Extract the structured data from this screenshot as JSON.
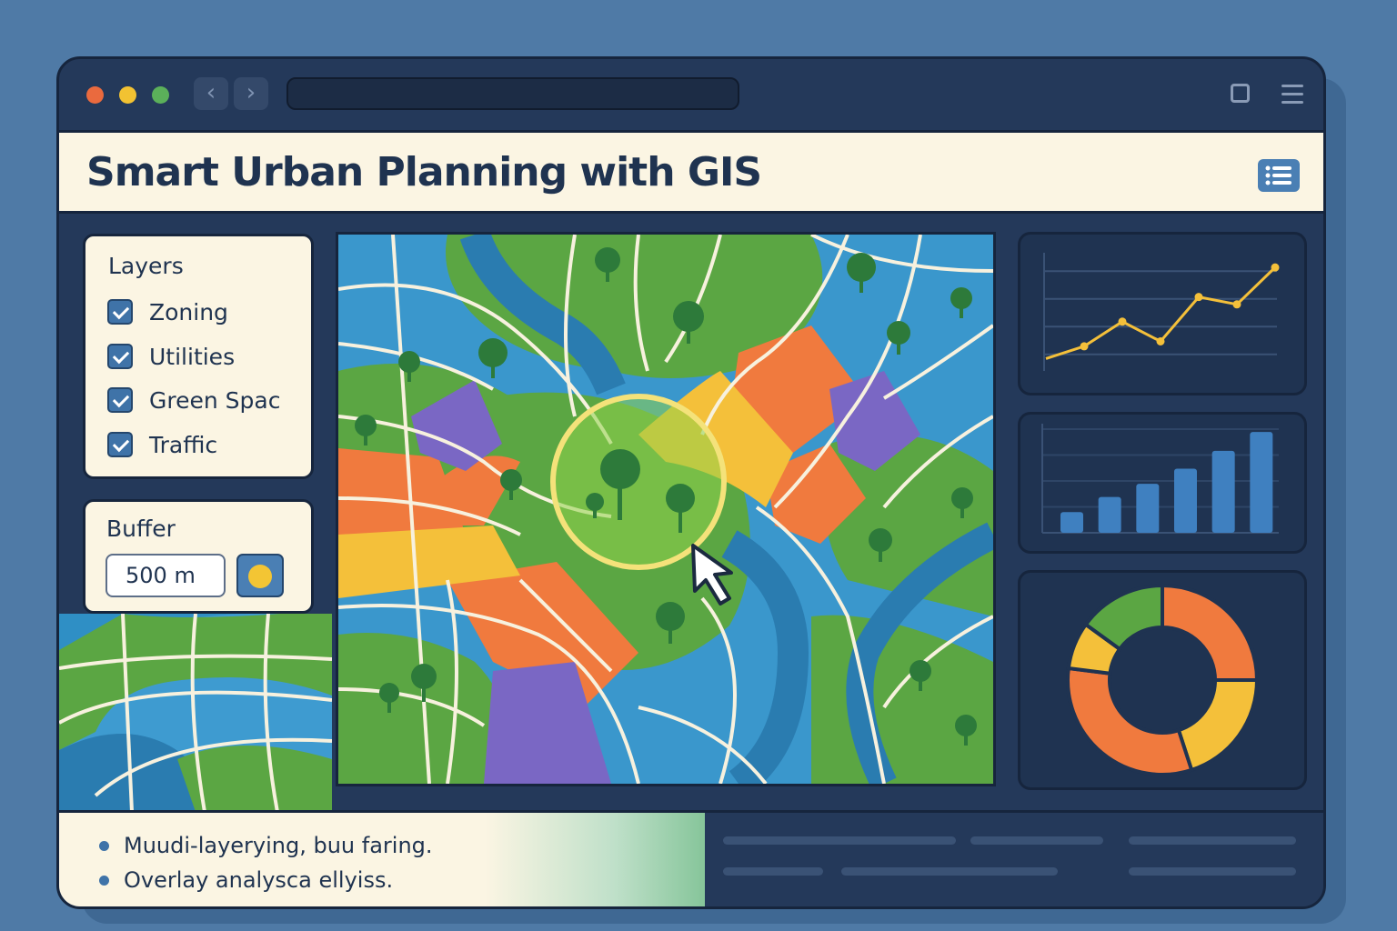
{
  "header": {
    "title": "Smart Urban Planning with GIS",
    "menu_icon": "list-icon"
  },
  "window": {
    "controls": [
      "close-dot",
      "minimize-dot",
      "maximize-dot"
    ],
    "control_colors": [
      "#ea6a3e",
      "#f2c232",
      "#5bb05a"
    ],
    "address_bar": ""
  },
  "layers": {
    "title": "Layers",
    "items": [
      {
        "label": "Zoning",
        "checked": true
      },
      {
        "label": "Utilities",
        "checked": true
      },
      {
        "label": "Green Spac",
        "checked": true
      },
      {
        "label": "Traffic",
        "checked": true
      }
    ]
  },
  "buffer": {
    "title": "Buffer",
    "value": "500 m"
  },
  "charts": {
    "line": {
      "type": "line",
      "values": [
        1,
        2,
        4,
        2.4,
        6,
        5.4,
        8.4
      ]
    },
    "bar": {
      "type": "bar",
      "values": [
        2.2,
        3.8,
        5.2,
        6.8,
        8.7,
        10.7
      ]
    },
    "donut": {
      "type": "pie",
      "slices": [
        {
          "value": 25,
          "color": "#f07a3e"
        },
        {
          "value": 20,
          "color": "#f4c03a"
        },
        {
          "value": 32,
          "color": "#f07a3e"
        },
        {
          "value": 8,
          "color": "#f4c03a"
        },
        {
          "value": 15,
          "color": "#5ba643"
        }
      ]
    }
  },
  "footer": {
    "bullets": [
      "Muudi-layerying, buu faring.",
      "Overlay analysca ellyiss."
    ]
  },
  "colors": {
    "green": "#5ba643",
    "blue": "#2f8fc5",
    "orange": "#f07a3e",
    "yellow": "#f4c03a",
    "purple": "#7a67c4",
    "accent": "#4a7fb4"
  }
}
